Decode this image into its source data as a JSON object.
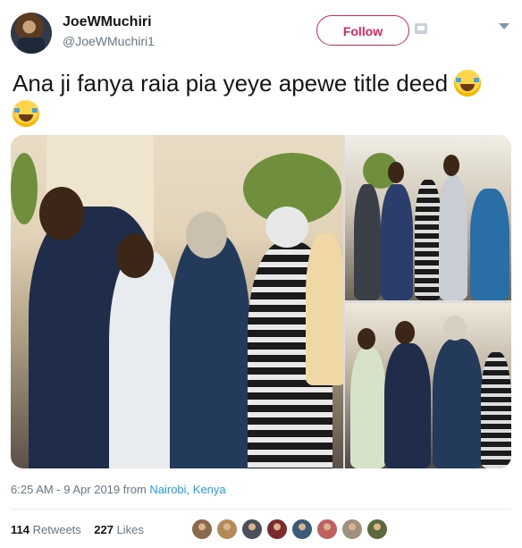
{
  "header": {
    "display_name": "JoeWMuchiri",
    "handle": "@JoeWMuchiri1",
    "follow_label": "Follow"
  },
  "tweet": {
    "text": "Ana ji fanya raia pia yeye apewe title deed"
  },
  "meta": {
    "time": "6:25 AM - 9 Apr 2019 from ",
    "location": "Nairobi, Kenya"
  },
  "stats": {
    "retweets_count": "114",
    "retweets_label": " Retweets",
    "likes_count": "227",
    "likes_label": " Likes"
  },
  "likers": [
    {
      "color": "#8a6a4a"
    },
    {
      "color": "#b48a5a"
    },
    {
      "color": "#4a4f5a"
    },
    {
      "color": "#7a2c2c"
    },
    {
      "color": "#3a5a7a"
    },
    {
      "color": "#c06060"
    },
    {
      "color": "#a09080"
    },
    {
      "color": "#5a6a3a"
    }
  ],
  "colors": {
    "accent": "#e0245e",
    "link": "#1da1f2",
    "muted": "#657786"
  },
  "icons": [
    "avatar",
    "envelope-icon",
    "chevron-down-icon",
    "tears-of-joy-emoji"
  ]
}
